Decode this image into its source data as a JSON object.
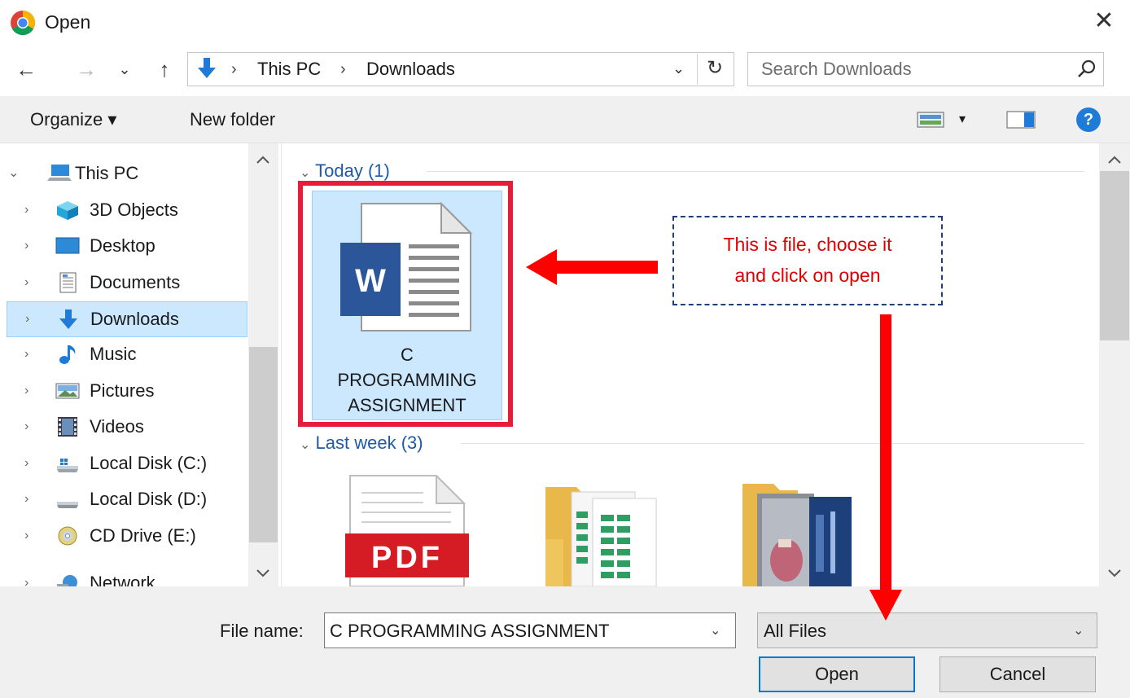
{
  "window": {
    "title": "Open",
    "close_glyph": "✕",
    "app_icon": "chrome-icon"
  },
  "nav": {
    "back": "←",
    "forward": "→",
    "recent": "⌄",
    "up": "↑",
    "refresh": "↻"
  },
  "address": {
    "icon": "downloads-arrow-icon",
    "crumbs": [
      "This PC",
      "Downloads"
    ],
    "separator": "›",
    "dropdown": "⌄"
  },
  "search": {
    "placeholder": "Search Downloads",
    "icon": "search-icon"
  },
  "toolbar": {
    "organize": "Organize ▾",
    "new_folder": "New folder",
    "view_icon": "view-options-icon",
    "view_dd": "▾",
    "preview_icon": "preview-pane-icon",
    "help": "?"
  },
  "sidebar": {
    "items": [
      {
        "label": "This PC",
        "icon": "computer-icon",
        "expanded": true
      },
      {
        "label": "3D Objects",
        "icon": "3d-objects-icon"
      },
      {
        "label": "Desktop",
        "icon": "desktop-icon"
      },
      {
        "label": "Documents",
        "icon": "documents-icon"
      },
      {
        "label": "Downloads",
        "icon": "downloads-icon",
        "selected": true
      },
      {
        "label": "Music",
        "icon": "music-icon"
      },
      {
        "label": "Pictures",
        "icon": "pictures-icon"
      },
      {
        "label": "Videos",
        "icon": "videos-icon"
      },
      {
        "label": "Local Disk (C:)",
        "icon": "windows-drive-icon"
      },
      {
        "label": "Local Disk (D:)",
        "icon": "drive-icon"
      },
      {
        "label": "CD Drive (E:)",
        "icon": "cd-drive-icon"
      },
      {
        "label": "Network",
        "icon": "network-icon"
      }
    ]
  },
  "groups": [
    {
      "label": "Today (1)"
    },
    {
      "label": "Last week (3)"
    }
  ],
  "files": {
    "today": [
      {
        "name": "C PROGRAMMING ASSIGNMENT",
        "name_lines": [
          "C",
          "PROGRAMMING",
          "ASSIGNMENT"
        ],
        "icon": "word-document-icon",
        "badge": "W",
        "selected": true
      }
    ],
    "last_week": [
      {
        "icon": "pdf-file-icon",
        "badge": "PDF"
      },
      {
        "icon": "folder-spreadsheet-icon"
      },
      {
        "icon": "folder-photos-icon"
      }
    ]
  },
  "annotation": {
    "lines": [
      "This is file, choose it",
      "and click on open"
    ],
    "color": "#e00000"
  },
  "footer": {
    "file_name_label": "File name:",
    "file_name_value": "C PROGRAMMING ASSIGNMENT",
    "file_type_value": "All Files",
    "dropdown_glyph": "⌄",
    "open": "Open",
    "cancel": "Cancel"
  },
  "colors": {
    "accent": "#0078d7",
    "selection": "#cce8ff",
    "highlight_border": "#e51c3a",
    "word_blue": "#2b579a",
    "pdf_red": "#d51c24",
    "arrow_red": "#ff0000"
  }
}
